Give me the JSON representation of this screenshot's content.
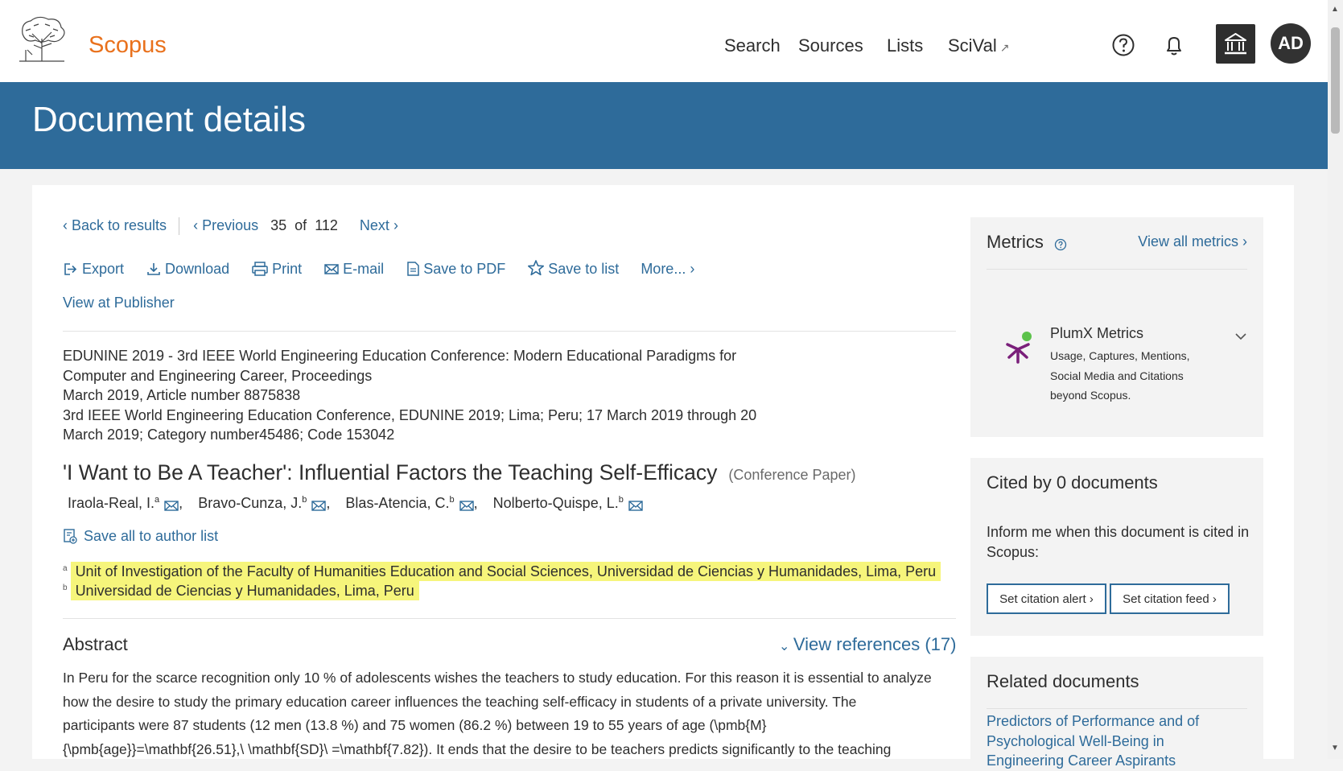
{
  "header": {
    "brand": "Scopus",
    "nav": [
      {
        "label": "Search"
      },
      {
        "label": "Sources"
      },
      {
        "label": "Lists"
      },
      {
        "label": "SciVal",
        "external_mark": "↗"
      }
    ],
    "avatar_initials": "AD",
    "icons": [
      "help-icon",
      "bell-icon",
      "institution-icon"
    ]
  },
  "banner": {
    "title": "Document details"
  },
  "navigation": {
    "back": "Back to results",
    "previous": "Previous",
    "position": "35",
    "of": "of",
    "total": "112",
    "next": "Next"
  },
  "toolbar": {
    "export": "Export",
    "download": "Download",
    "print": "Print",
    "email": "E-mail",
    "save_pdf": "Save to PDF",
    "save_list": "Save to list",
    "more": "More..."
  },
  "view_publisher": "View at Publisher",
  "source": {
    "line1": "EDUNINE 2019 - 3rd IEEE World Engineering Education Conference: Modern Educational Paradigms for",
    "line2": "Computer and Engineering Career, Proceedings",
    "line3": "March 2019, Article number 8875838",
    "line4": "3rd IEEE World Engineering Education Conference, EDUNINE 2019; Lima; Peru; 17 March 2019 through 20",
    "line5": "March 2019; Category number45486; Code 153042"
  },
  "document": {
    "title": "'I Want to Be A Teacher': Influential Factors the Teaching Self-Efficacy",
    "type": "(Conference Paper)"
  },
  "authors": [
    {
      "name": "Iraola-Real, I.",
      "sup": "a"
    },
    {
      "name": "Bravo-Cunza, J.",
      "sup": "b"
    },
    {
      "name": "Blas-Atencia, C.",
      "sup": "b"
    },
    {
      "name": "Nolberto-Quispe, L.",
      "sup": "b"
    }
  ],
  "author_separator": ",",
  "save_authors": "Save all to author list",
  "affiliations": [
    {
      "sup": "a",
      "text": "Unit of Investigation of the Faculty of Humanities Education and Social Sciences, Universidad de Ciencias y Humanidades, Lima, Peru"
    },
    {
      "sup": "b",
      "text": "Universidad de Ciencias y Humanidades, Lima, Peru"
    }
  ],
  "abstract": {
    "heading": "Abstract",
    "view_refs": "View references (17)",
    "line1": "In Peru for the scarce recognition only 10 % of adolescents wishes the teachers to study education. For this reason it is essential to analyze",
    "line2": "how the desire to study the primary education career influences the teaching self-efficacy in students of a private university. The",
    "line3": "participants were 87 students (12 men (13.8 %) and 75 women (86.2 %) between 19 to 55 years of age (\\pmb{M}",
    "line4": "{\\pmb{age}}=\\mathbf{26.51},\\ \\mathbf{SD}\\ =\\mathbf{7.82}). It ends that the desire to be teachers predicts significantly to the teaching"
  },
  "metrics": {
    "title": "Metrics",
    "view_all": "View all metrics",
    "plumx_title": "PlumX Metrics",
    "plumx_desc_1": "Usage, Captures, Mentions,",
    "plumx_desc_2": "Social Media and Citations",
    "plumx_desc_3": "beyond Scopus."
  },
  "cited": {
    "title": "Cited by 0 documents",
    "inform": "Inform me when this document is cited in Scopus:",
    "alert_btn": "Set citation alert",
    "feed_btn": "Set citation feed"
  },
  "related": {
    "title": "Related documents",
    "link1_line1": "Predictors of Performance and of",
    "link1_line2": "Psychological Well-Being in",
    "link1_line3": "Engineering Career Aspirants"
  },
  "colors": {
    "accent": "#2e6b9a",
    "brand": "#e9711c",
    "highlight": "#f6f57b",
    "plumx": "#7a1f7a"
  }
}
